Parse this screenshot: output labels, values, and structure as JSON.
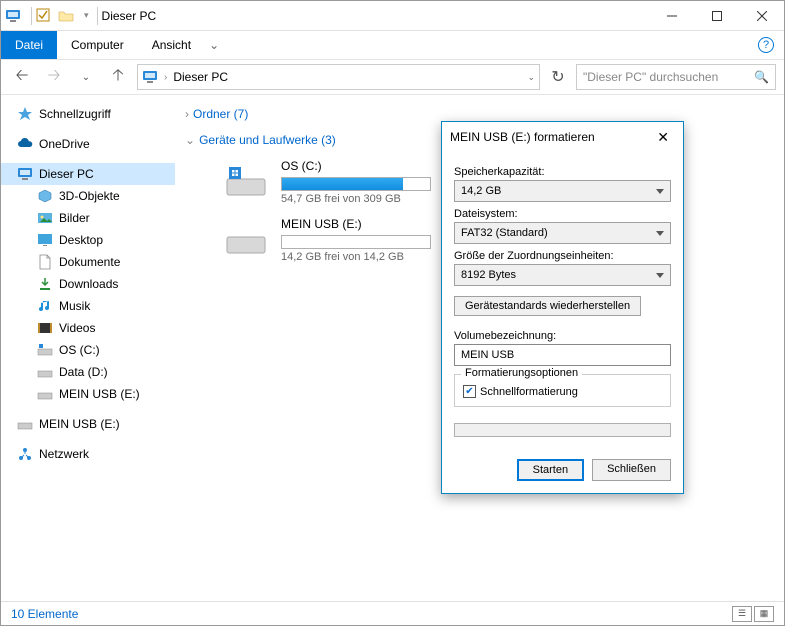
{
  "title": "Dieser PC",
  "tabs": {
    "file": "Datei",
    "computer": "Computer",
    "view": "Ansicht"
  },
  "address": {
    "text": "Dieser PC"
  },
  "search": {
    "placeholder": "\"Dieser PC\" durchsuchen"
  },
  "sidebar": {
    "quickaccess": "Schnellzugriff",
    "onedrive": "OneDrive",
    "thispc": "Dieser PC",
    "items": {
      "objects3d": "3D-Objekte",
      "pictures": "Bilder",
      "desktop": "Desktop",
      "documents": "Dokumente",
      "downloads": "Downloads",
      "music": "Musik",
      "videos": "Videos",
      "osc": "OS (C:)",
      "datad": "Data (D:)",
      "usb_nested": "MEIN USB (E:)",
      "usb": "MEIN USB (E:)",
      "network": "Netzwerk"
    }
  },
  "main": {
    "folders": {
      "label": "Ordner (7)"
    },
    "drives": {
      "label": "Geräte und Laufwerke (3)",
      "os": {
        "name": "OS (C:)",
        "sub": "54,7 GB frei von 309 GB",
        "pct": 82
      },
      "usb": {
        "name": "MEIN USB (E:)",
        "sub": "14,2 GB frei von 14,2 GB",
        "pct": 0
      }
    }
  },
  "status": {
    "text": "10 Elemente"
  },
  "dialog": {
    "title": "MEIN USB (E:) formatieren",
    "capacity_label": "Speicherkapazität:",
    "capacity_value": "14,2 GB",
    "fs_label": "Dateisystem:",
    "fs_value": "FAT32 (Standard)",
    "alloc_label": "Größe der Zuordnungseinheiten:",
    "alloc_value": "8192 Bytes",
    "restore": "Gerätestandards wiederherstellen",
    "vol_label": "Volumebezeichnung:",
    "vol_value": "MEIN USB",
    "opts_label": "Formatierungsoptionen",
    "quick": "Schnellformatierung",
    "start": "Starten",
    "close": "Schließen"
  }
}
